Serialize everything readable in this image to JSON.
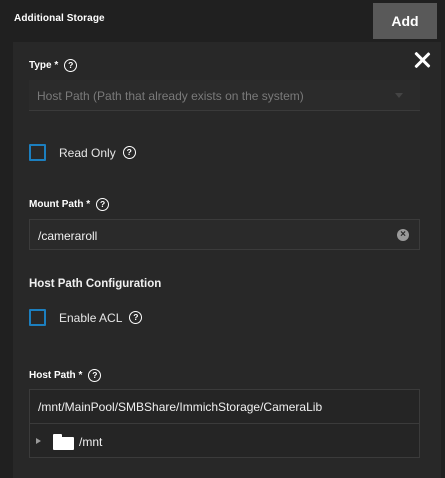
{
  "header": {
    "title": "Additional Storage",
    "add_label": "Add"
  },
  "form": {
    "type": {
      "label": "Type *",
      "help_glyph": "?",
      "value": "Host Path (Path that already exists on the system)"
    },
    "read_only": {
      "label": "Read Only",
      "checked": false,
      "help_glyph": "?"
    },
    "mount_path": {
      "label": "Mount Path *",
      "help_glyph": "?",
      "value": "/cameraroll",
      "clear_glyph": "×"
    },
    "host_path_config": {
      "title": "Host Path Configuration",
      "enable_acl": {
        "label": "Enable ACL",
        "checked": false,
        "help_glyph": "?"
      }
    },
    "host_path": {
      "label": "Host Path *",
      "help_glyph": "?",
      "value": "/mnt/MainPool/SMBShare/ImmichStorage/CameraLib",
      "tree": [
        {
          "label": "/mnt",
          "icon": "folder-icon",
          "expanded": false
        }
      ]
    }
  },
  "colors": {
    "background": "#202020",
    "panel": "#282828",
    "add_button": "#595959",
    "checkbox_border": "#1c7fbf",
    "muted_text": "#7a7a7a"
  }
}
